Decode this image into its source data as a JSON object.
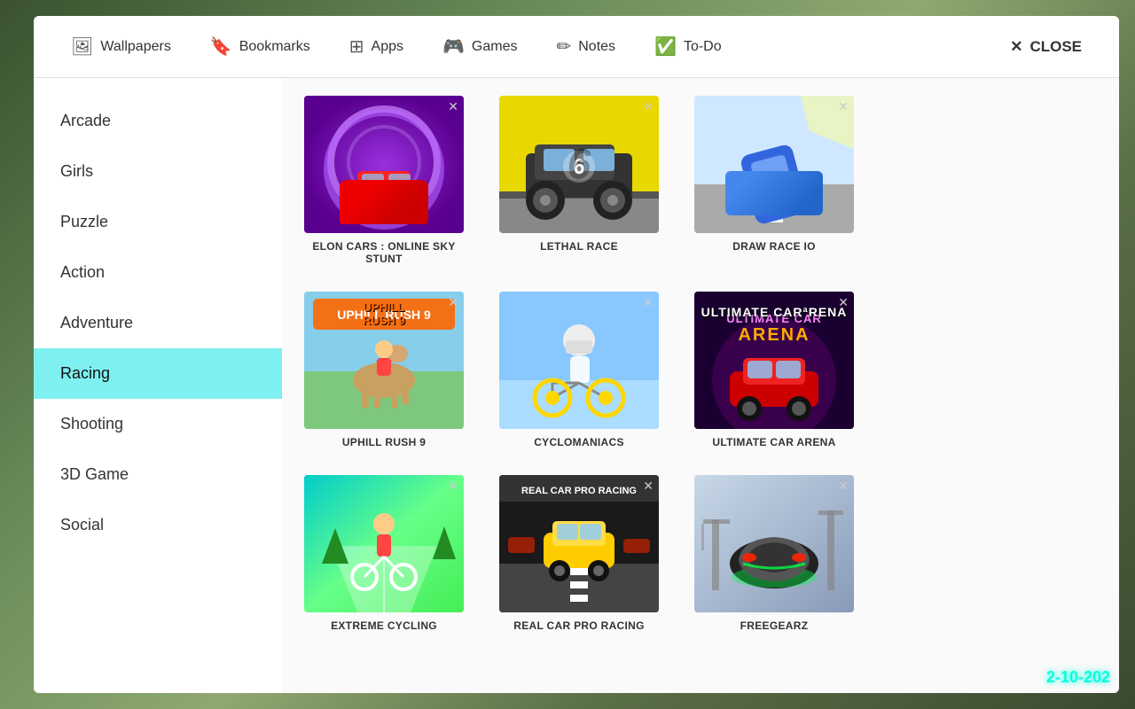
{
  "header": {
    "nav_items": [
      {
        "id": "wallpapers",
        "label": "Wallpapers",
        "icon": "🖼"
      },
      {
        "id": "bookmarks",
        "label": "Bookmarks",
        "icon": "🔖"
      },
      {
        "id": "apps",
        "label": "Apps",
        "icon": "⊞"
      },
      {
        "id": "games",
        "label": "Games",
        "icon": "🎮"
      },
      {
        "id": "notes",
        "label": "Notes",
        "icon": "✏"
      },
      {
        "id": "todo",
        "label": "To-Do",
        "icon": "✅"
      }
    ],
    "close_label": "CLOSE",
    "close_icon": "✕"
  },
  "sidebar": {
    "items": [
      {
        "id": "arcade",
        "label": "Arcade",
        "active": false
      },
      {
        "id": "girls",
        "label": "Girls",
        "active": false
      },
      {
        "id": "puzzle",
        "label": "Puzzle",
        "active": false
      },
      {
        "id": "action",
        "label": "Action",
        "active": false
      },
      {
        "id": "adventure",
        "label": "Adventure",
        "active": false
      },
      {
        "id": "racing",
        "label": "Racing",
        "active": true
      },
      {
        "id": "shooting",
        "label": "Shooting",
        "active": false
      },
      {
        "id": "3dgame",
        "label": "3D Game",
        "active": false
      },
      {
        "id": "social",
        "label": "Social",
        "active": false
      }
    ]
  },
  "games": [
    {
      "id": "elon-cars",
      "title": "ELON CARS : ONLINE SKY STUNT",
      "thumb_class": "thumb-elon"
    },
    {
      "id": "lethal-race",
      "title": "LETHAL RACE",
      "thumb_class": "thumb-lethal"
    },
    {
      "id": "draw-race",
      "title": "DRAW RACE IO",
      "thumb_class": "thumb-draw"
    },
    {
      "id": "uphill-rush",
      "title": "UPHILL RUSH 9",
      "thumb_class": "thumb-uphill"
    },
    {
      "id": "cyclomaniacs",
      "title": "CYCLOMANIACS",
      "thumb_class": "thumb-cyclo"
    },
    {
      "id": "ultimate-arena",
      "title": "ULTIMATE CAR ARENA",
      "thumb_class": "thumb-arena"
    },
    {
      "id": "extreme-cycling",
      "title": "EXTREME CYCLING",
      "thumb_class": "thumb-cycling"
    },
    {
      "id": "real-car-pro",
      "title": "REAL CAR PRO RACING",
      "thumb_class": "thumb-realcar"
    },
    {
      "id": "freegearz",
      "title": "FREEGEARZ",
      "thumb_class": "thumb-freegearz"
    }
  ],
  "clock": {
    "date": "2-10-20",
    "time_suffix": "2"
  }
}
